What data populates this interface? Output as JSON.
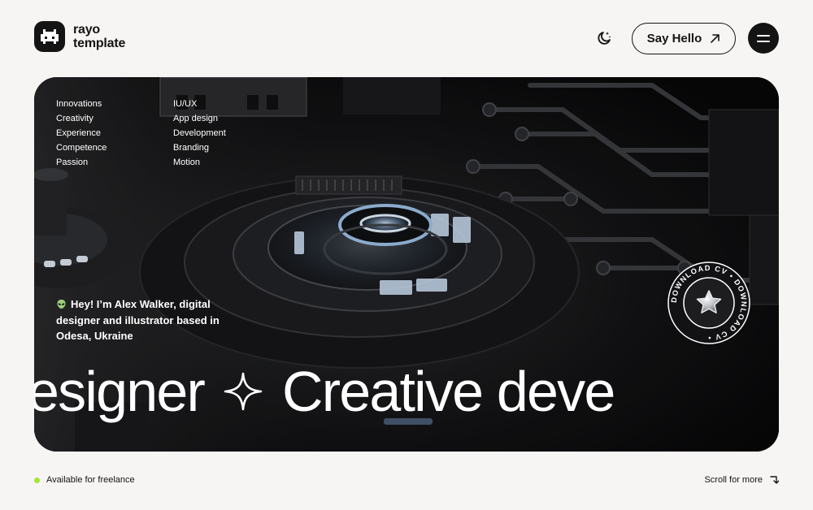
{
  "brand": {
    "line1": "rayo",
    "line2": "template",
    "icon": "pixel-alien-logo-icon"
  },
  "header": {
    "theme_icon": "moon-stars-icon",
    "cta_label": "Say Hello",
    "cta_icon": "arrow-up-right-icon",
    "menu_icon": "hamburger-icon"
  },
  "hero": {
    "list_left": [
      "Innovations",
      "Creativity",
      "Experience",
      "Competence",
      "Passion"
    ],
    "list_right": [
      "IU/UX",
      "App design",
      "Development",
      "Branding",
      "Motion"
    ],
    "intro_icon": "alien-emoji-icon",
    "intro": "Hey! I’m Alex Walker, digital designer and illustrator based in Odesa, Ukraine",
    "marquee_left": "esigner",
    "marquee_right": "Creative deve",
    "marquee_separator_icon": "sparkle-star-icon",
    "badge_text": "DOWNLOAD CV • DOWNLOAD CV • ",
    "badge_icon": "chrome-star-icon"
  },
  "footer": {
    "status": "Available for freelance",
    "status_color": "#a3e635",
    "scroll_label": "Scroll for more",
    "scroll_icon": "arrow-down-right-icon"
  },
  "colors": {
    "background": "#f7f5f3",
    "ink": "#141414",
    "hero_bg": "#0e0e0f",
    "accent": "#a3e635"
  }
}
